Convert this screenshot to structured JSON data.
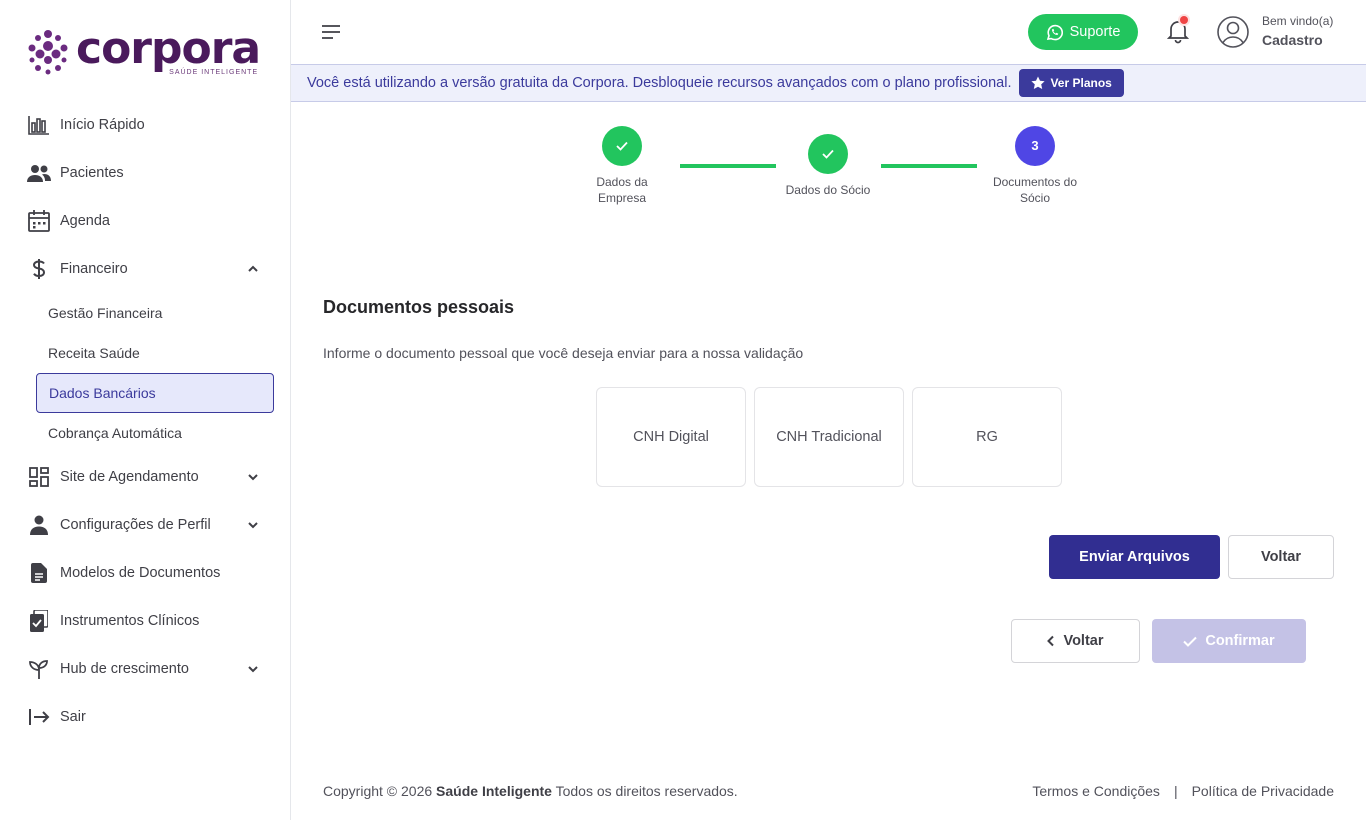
{
  "brand": {
    "name": "corpora",
    "tagline": "SAÚDE INTELIGENTE",
    "color": "#4a1a5c"
  },
  "sidebar": {
    "items": [
      {
        "label": "Início Rápido",
        "icon": "bar-chart-icon"
      },
      {
        "label": "Pacientes",
        "icon": "users-icon"
      },
      {
        "label": "Agenda",
        "icon": "calendar-icon"
      },
      {
        "label": "Financeiro",
        "icon": "dollar-icon",
        "expanded": true
      },
      {
        "label": "Site de Agendamento",
        "icon": "grid-icon"
      },
      {
        "label": "Configurações de Perfil",
        "icon": "user-icon"
      },
      {
        "label": "Modelos de Documentos",
        "icon": "document-icon"
      },
      {
        "label": "Instrumentos Clínicos",
        "icon": "clipboard-icon"
      },
      {
        "label": "Hub de crescimento",
        "icon": "sprout-icon"
      },
      {
        "label": "Sair",
        "icon": "logout-icon"
      }
    ],
    "financeiro_sub": [
      {
        "label": "Gestão Financeira"
      },
      {
        "label": "Receita Saúde"
      },
      {
        "label": "Dados Bancários",
        "active": true
      },
      {
        "label": "Cobrança Automática"
      }
    ]
  },
  "header": {
    "support_label": "Suporte",
    "greeting": "Bem vindo(a)",
    "user_name": "Cadastro"
  },
  "banner": {
    "message": "Você está utilizando a versão gratuita da Corpora. Desbloqueie recursos avançados com o plano profissional.",
    "button_label": "Ver Planos"
  },
  "stepper": {
    "steps": [
      {
        "label_line1": "Dados da",
        "label_line2": "Empresa",
        "status": "done"
      },
      {
        "label_line1": "Dados do Sócio",
        "label_line2": "",
        "status": "done"
      },
      {
        "number": "3",
        "label_line1": "Documentos do",
        "label_line2": "Sócio",
        "status": "current"
      }
    ]
  },
  "content": {
    "title": "Documentos pessoais",
    "description": "Informe o documento pessoal que você deseja enviar para a nossa validação",
    "documents": [
      "CNH Digital",
      "CNH Tradicional",
      "RG"
    ],
    "send_label": "Enviar Arquivos",
    "back_label": "Voltar",
    "back_nav_label": "Voltar",
    "confirm_label": "Confirmar"
  },
  "footer": {
    "copyright_prefix": "Copyright © 2026",
    "company": "Saúde Inteligente",
    "copyright_suffix": "Todos os direitos reservados.",
    "terms": "Termos e Condições",
    "privacy": "Política de Privacidade"
  },
  "colors": {
    "primary": "#312e91",
    "success": "#22c55e",
    "accent": "#4f46e5",
    "banner_bg": "#eef0fb"
  }
}
